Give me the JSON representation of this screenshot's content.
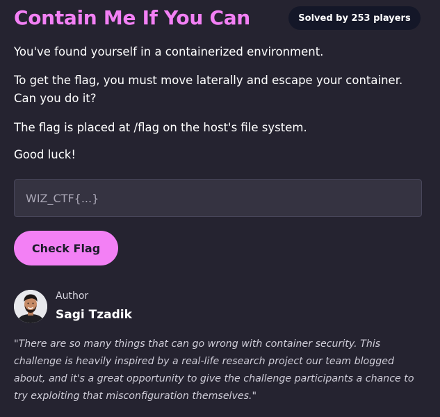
{
  "challenge": {
    "title": "Contain Me If You Can",
    "solved_badge": "Solved by 253 players",
    "description": [
      "You've found yourself in a containerized environment.",
      "To get the flag, you must move laterally and escape your container. Can you do it?",
      "The flag is placed at /flag on the host's file system.",
      "Good luck!"
    ]
  },
  "flag_form": {
    "placeholder": "WIZ_CTF{...}",
    "value": "",
    "submit_label": "Check Flag"
  },
  "author": {
    "label": "Author",
    "name": "Sagi Tzadik",
    "quote": "\"There are so many things that can go wrong with container security. This challenge is heavily inspired by a real-life research project our team blogged about, and it's a great opportunity to give the challenge participants a chance to try exploiting that misconfiguration themselves.\""
  },
  "colors": {
    "background": "#252330",
    "accent": "#f380f5",
    "badge_background": "#141728",
    "input_background": "#353341"
  }
}
